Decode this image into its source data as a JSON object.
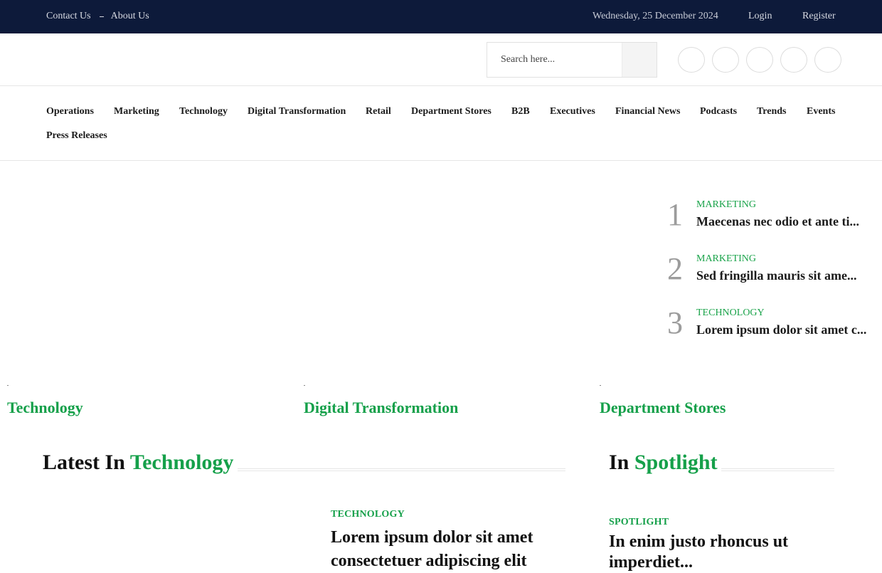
{
  "topbar": {
    "contact": "Contact Us",
    "about": "About Us",
    "date": "Wednesday, 25 December 2024",
    "login": "Login",
    "register": "Register"
  },
  "header": {
    "search_placeholder": "Search here...",
    "social_icons": [
      "facebook-icon",
      "twitter-icon",
      "instagram-icon",
      "linkedin-icon",
      "youtube-icon"
    ]
  },
  "nav": {
    "items": [
      "Operations",
      "Marketing",
      "Technology",
      "Digital Transformation",
      "Retail",
      "Department Stores",
      "B2B",
      "Executives",
      "Financial News",
      "Podcasts",
      "Trends",
      "Events"
    ],
    "second_row": "Press Releases"
  },
  "trending": [
    {
      "num": "1",
      "category": "MARKETING",
      "title": "Maecenas nec odio et ante ti..."
    },
    {
      "num": "2",
      "category": "MARKETING",
      "title": "Sed fringilla mauris sit ame..."
    },
    {
      "num": "3",
      "category": "TECHNOLOGY",
      "title": "Lorem ipsum dolor sit amet c..."
    }
  ],
  "category_cards": [
    "Technology",
    "Digital Transformation",
    "Department Stores"
  ],
  "latest": {
    "prefix": "Latest In",
    "highlight": "Technology",
    "post_category": "TECHNOLOGY",
    "post_title": "Lorem ipsum dolor sit amet consectetuer adipiscing elit"
  },
  "spotlight": {
    "prefix": "In",
    "highlight": "Spotlight",
    "post_category": "SPOTLIGHT",
    "post_title": "In enim justo rhoncus ut imperdiet..."
  },
  "colors": {
    "topbar_bg": "#0d1a3a",
    "accent_green": "#15a04a"
  }
}
